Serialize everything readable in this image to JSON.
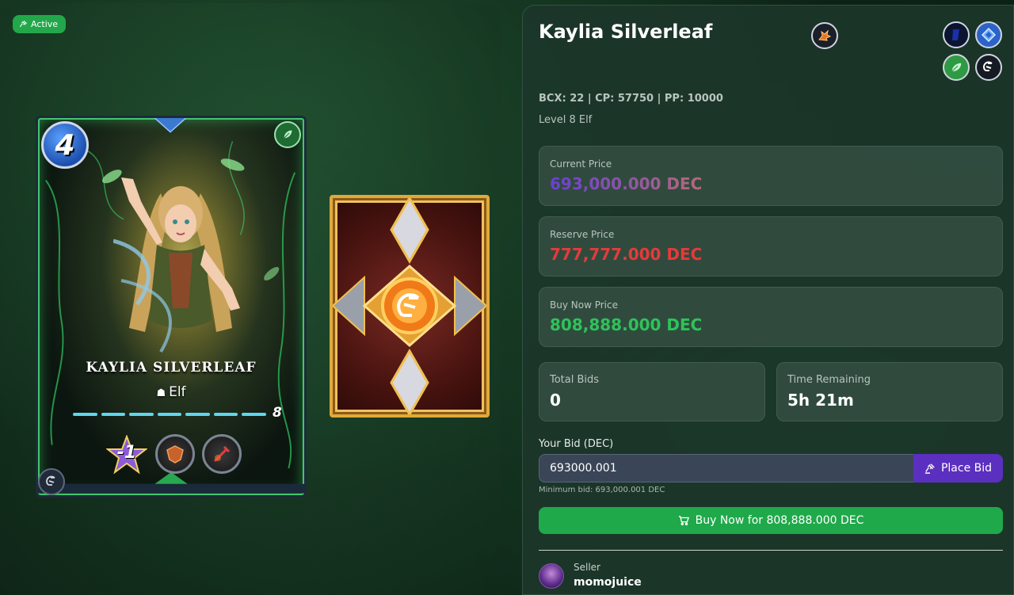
{
  "status": {
    "label": "Active",
    "color": "#22a84a"
  },
  "card": {
    "name": "Kaylia Silverleaf",
    "display_name": "KAYLIA SILVERLEAF",
    "mana": "4",
    "type": "Elf",
    "level": "8",
    "stat": "-1",
    "element_icon": "leaf-icon",
    "edition_icon": "splinterlands-logo-icon",
    "abilities": [
      "shield-ability-icon",
      "sword-ability-icon"
    ]
  },
  "details": {
    "title": "Kaylia Silverleaf",
    "meta": "BCX: 22 | CP: 57750 | PP: 10000",
    "subtitle": "Level 8 Elf",
    "corner_icons": [
      "foil-icon",
      "rarity-icon",
      "earth-element-icon",
      "edition-icon"
    ]
  },
  "prices": {
    "current_label": "Current Price",
    "current_value": "693,000.000 DEC",
    "reserve_label": "Reserve Price",
    "reserve_value": "777,777.000 DEC",
    "buy_label": "Buy Now Price",
    "buy_value": "808,888.000 DEC"
  },
  "stats": {
    "bids_label": "Total Bids",
    "bids_value": "0",
    "time_label": "Time Remaining",
    "time_value": "5h 21m"
  },
  "bid": {
    "label": "Your Bid (DEC)",
    "value": "693000.001",
    "button": "Place Bid",
    "min_text": "Minimum bid: 693,000.001 DEC"
  },
  "buy_now": {
    "button": "Buy Now for 808,888.000 DEC"
  },
  "seller": {
    "label": "Seller",
    "name": "momojuice"
  },
  "colors": {
    "accent_green": "#1fa94a",
    "accent_purple": "#5b2fbf",
    "reserve_red": "#e63a3a",
    "buy_green": "#2fc25a"
  }
}
